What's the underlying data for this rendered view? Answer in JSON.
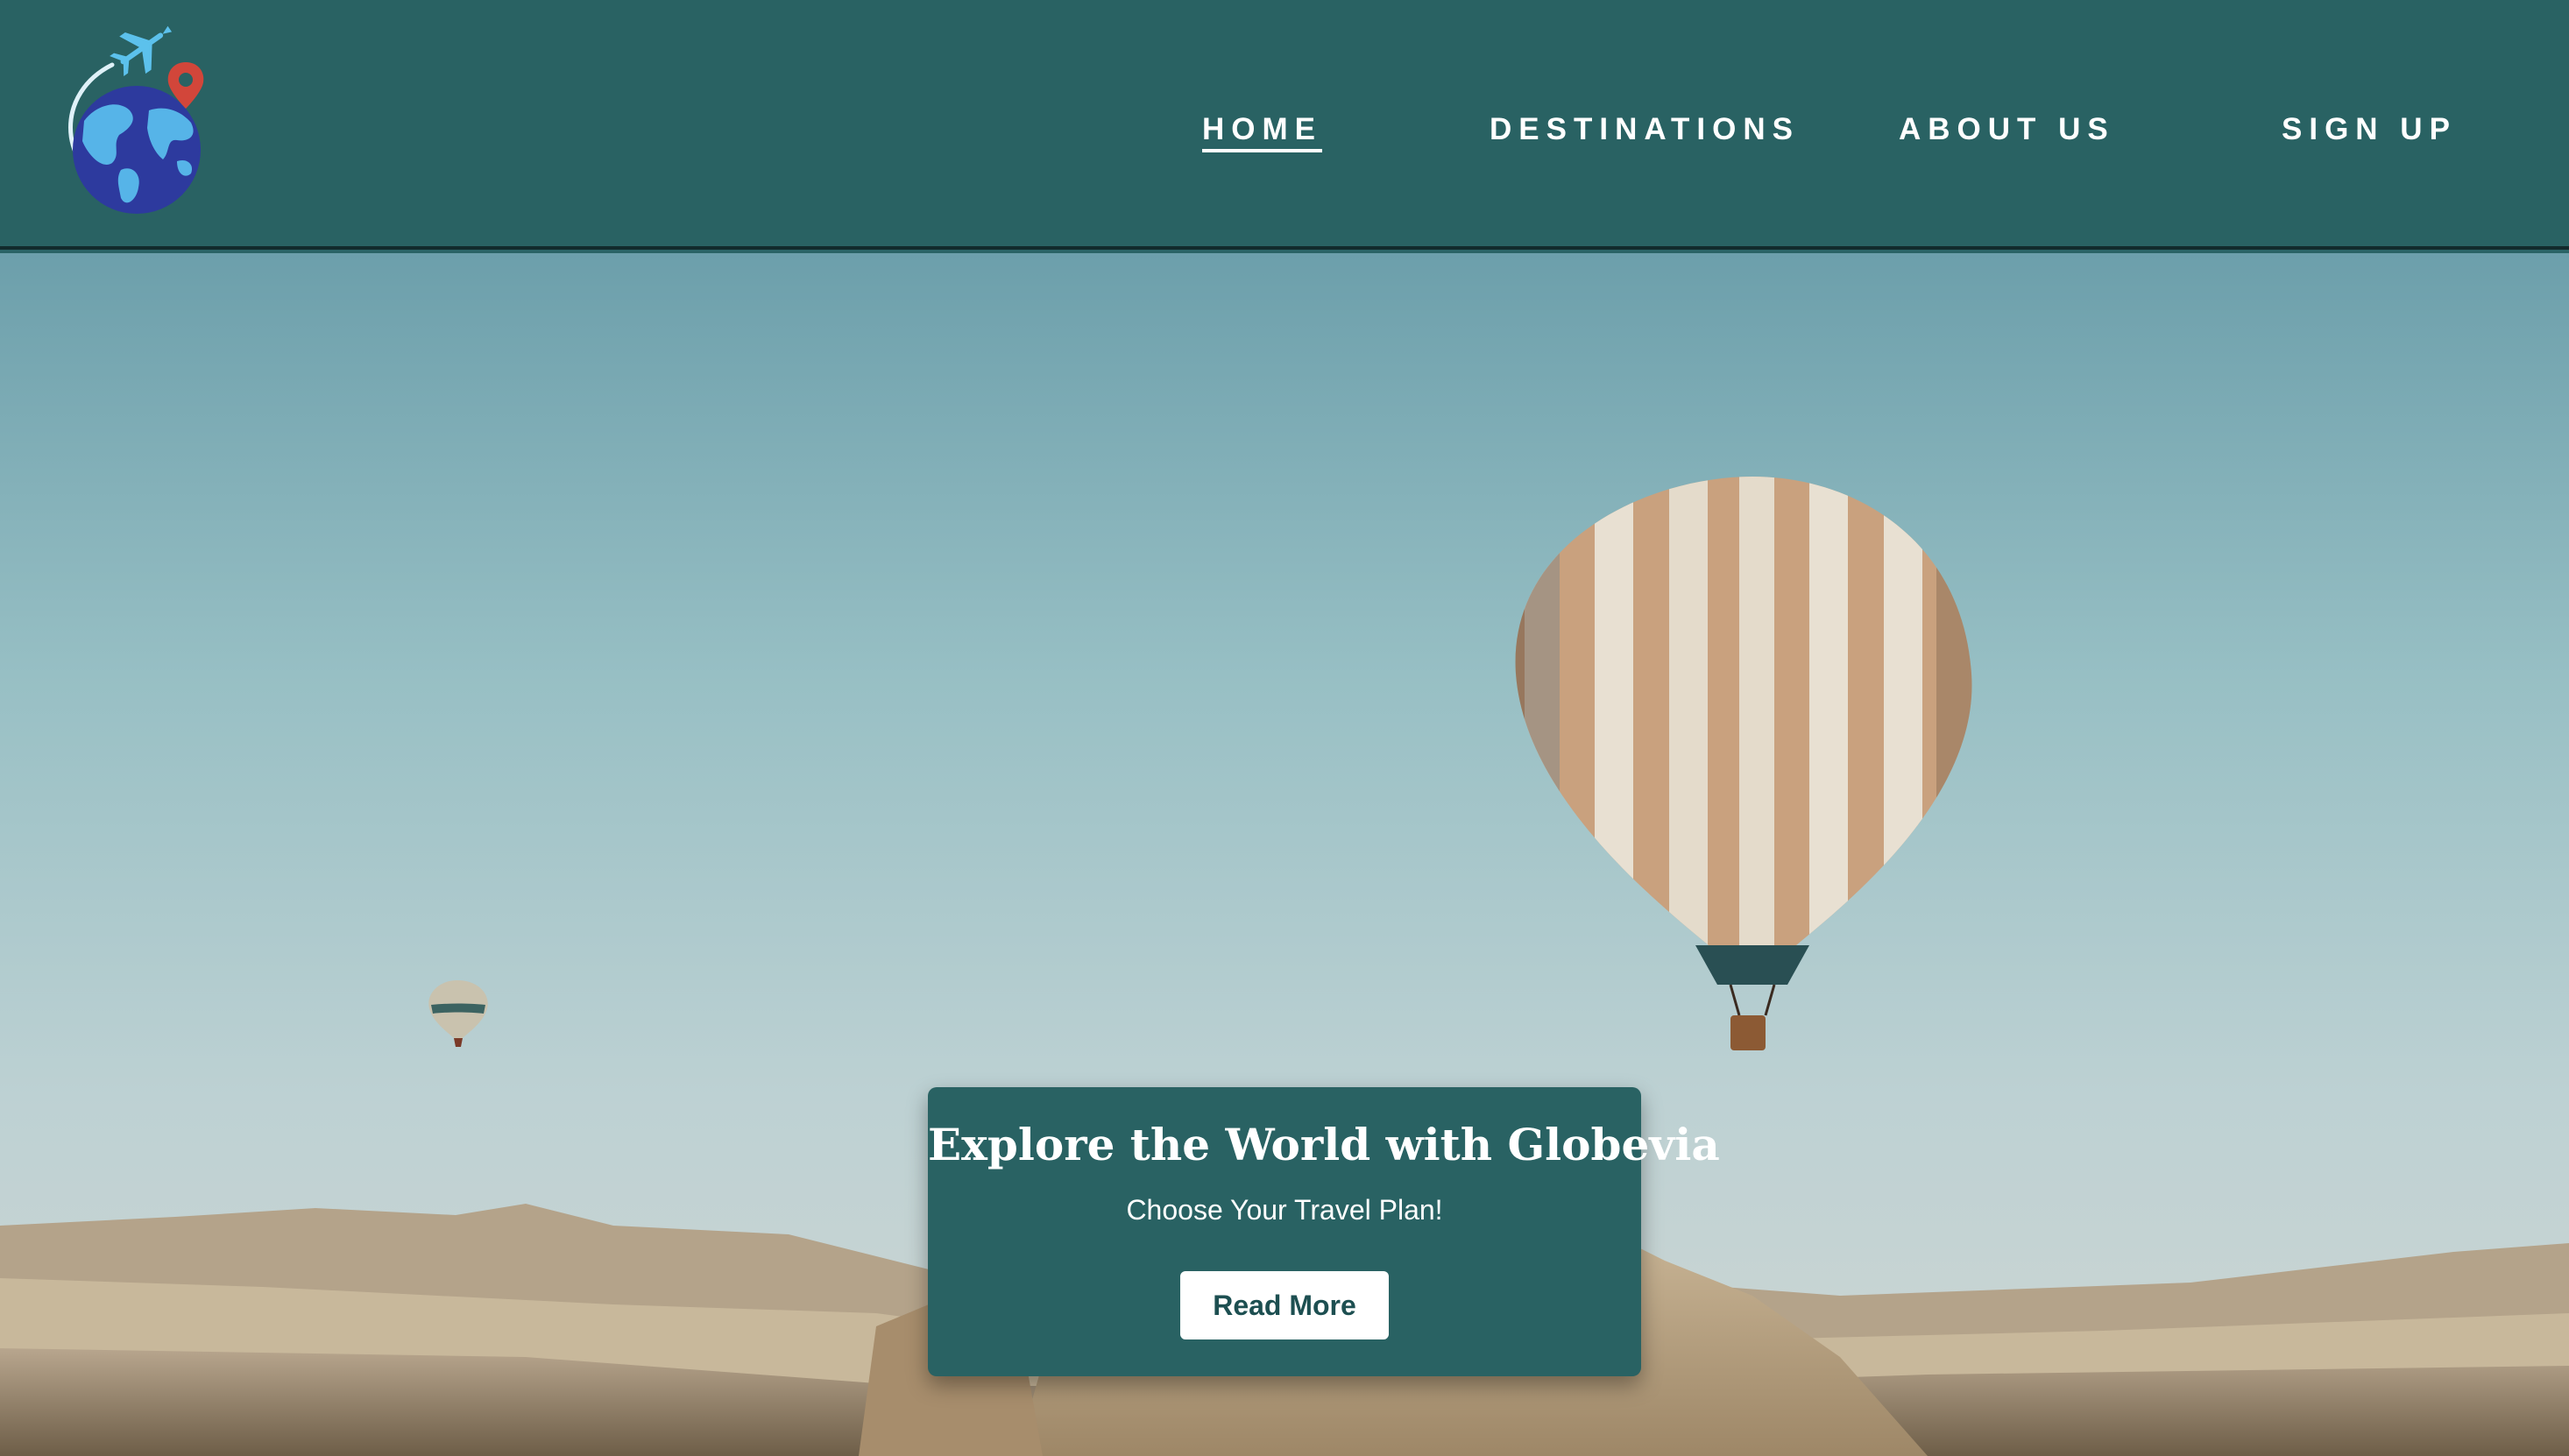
{
  "brand": {
    "logo_icon": "globe-travel-logo-icon"
  },
  "nav": {
    "items": [
      {
        "label": "HOME",
        "active": true
      },
      {
        "label": "DESTINATIONS",
        "active": false
      },
      {
        "label": "ABOUT US",
        "active": false
      },
      {
        "label": "SIGN UP",
        "active": false
      }
    ]
  },
  "hero": {
    "background": "hot-air-balloons-over-desert-landscape",
    "title": "Explore the World with Globevia",
    "subtitle": "Choose Your Travel Plan!",
    "button_label": "Read More"
  },
  "colors": {
    "primary": "#296263",
    "navbar_border": "#122b2c",
    "button_bg": "#ffffff",
    "button_text": "#1d4f51"
  }
}
